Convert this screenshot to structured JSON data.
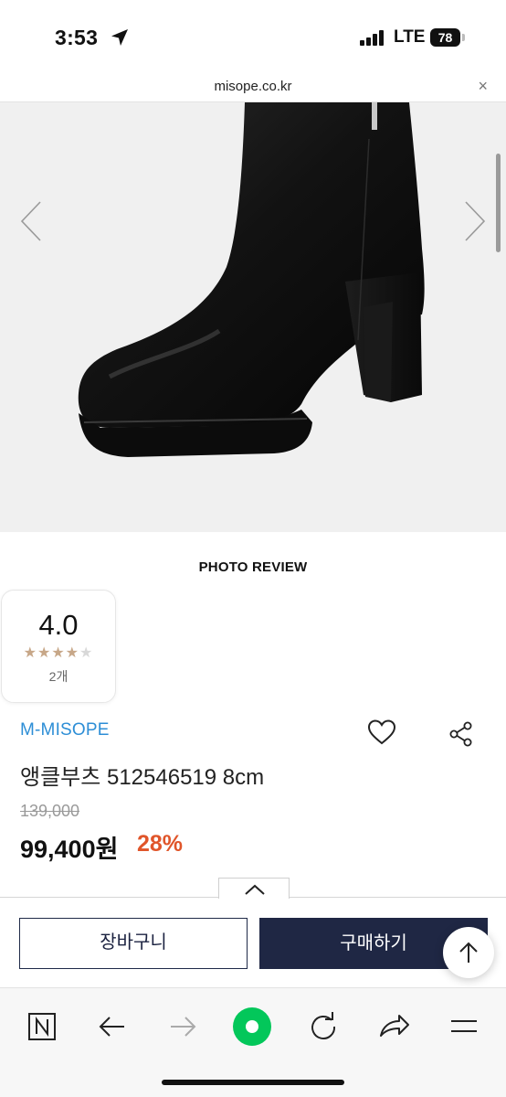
{
  "status_bar": {
    "time": "3:53",
    "network": "LTE",
    "battery": "78"
  },
  "url_bar": {
    "url": "misope.co.kr",
    "close": "×"
  },
  "photo_review": {
    "title": "PHOTO REVIEW",
    "score": "4.0",
    "stars": 4,
    "max_stars": 5,
    "count": "2개"
  },
  "product": {
    "brand": "M-MISOPE",
    "name": "앵클부츠 512546519 8cm",
    "original_price": "139,000",
    "sale_price": "99,400원",
    "discount": "28%"
  },
  "actions": {
    "cart_label": "장바구니",
    "buy_label": "구매하기"
  },
  "colors": {
    "brand": "#2d8ed6",
    "discount": "#e0552a",
    "buy_button": "#1f2744",
    "star": "#c7a788",
    "naver_green": "#03c75a"
  },
  "toolbar": {
    "items": [
      "naver-n-icon",
      "back-icon",
      "forward-icon",
      "green-home-icon",
      "refresh-icon",
      "share-arrow-icon",
      "menu-icon"
    ]
  }
}
